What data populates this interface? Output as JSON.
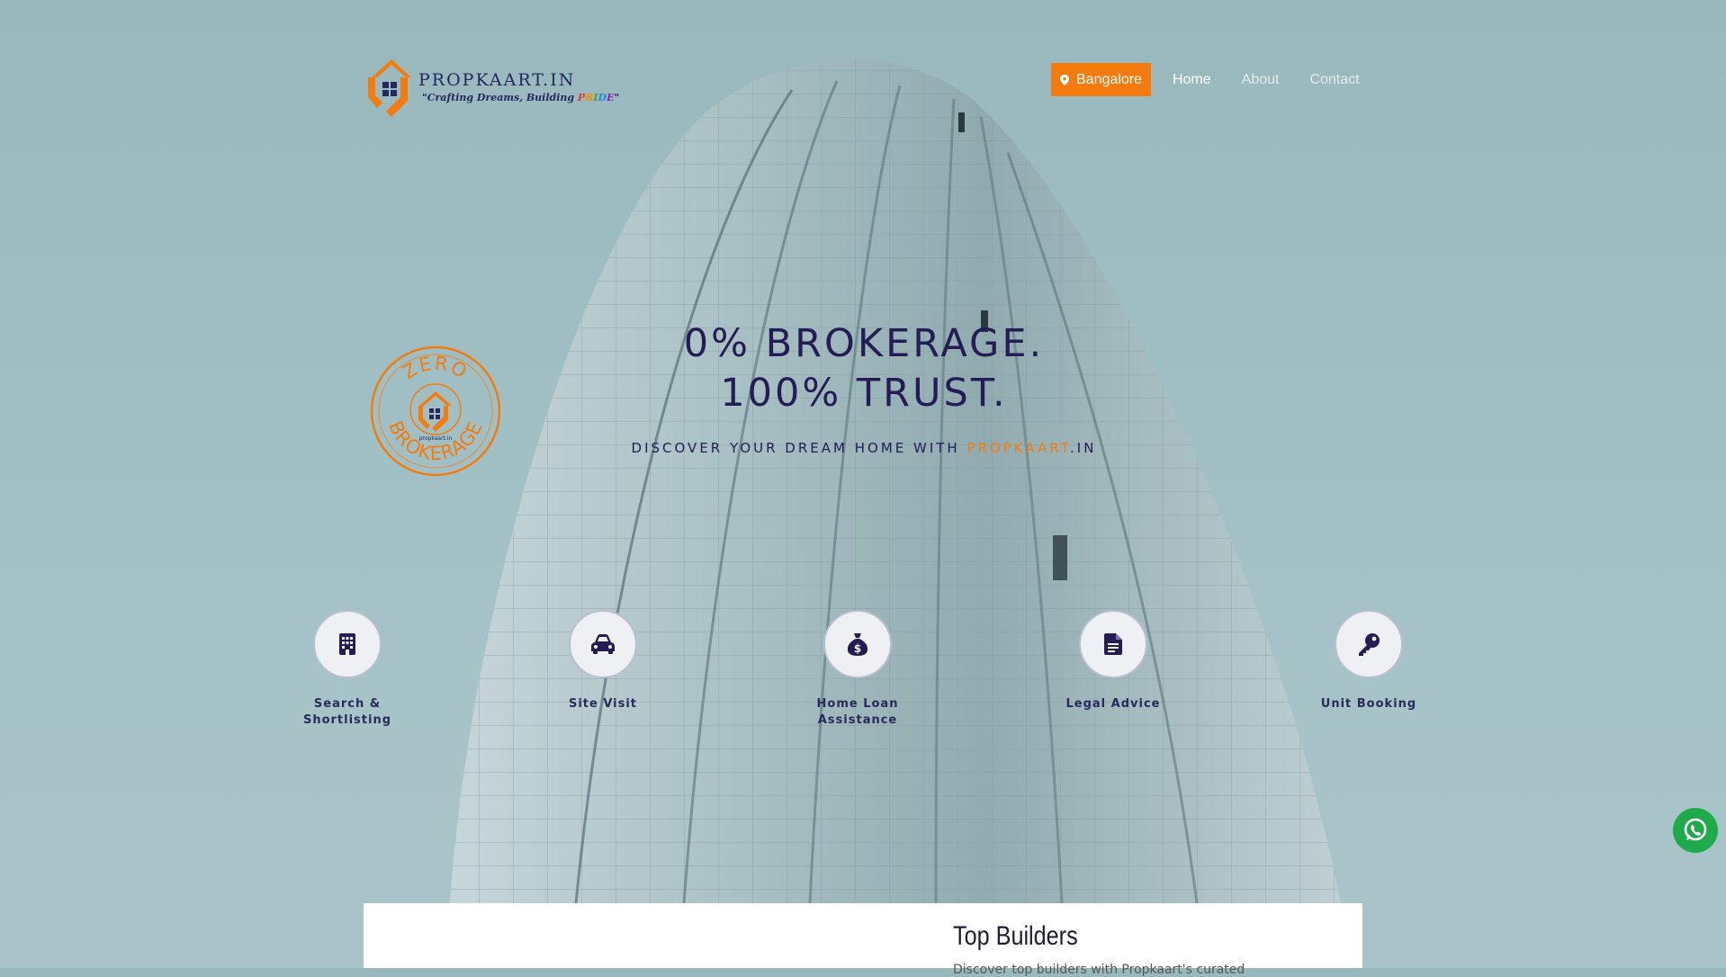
{
  "brand": {
    "name": "PROPKAART.IN",
    "tagline_parts": [
      "\"Crafting Dreams, Building ",
      "P",
      "R",
      "I",
      "D",
      "E",
      "\""
    ]
  },
  "nav": {
    "location": "Bangalore",
    "links": [
      "Home",
      "About",
      "Contact"
    ],
    "active": "Home"
  },
  "badge": {
    "top_text": "ZERO",
    "bottom_text": "BROKERAGE",
    "small_text": "propkaart.in"
  },
  "hero": {
    "headline_line1": "0% BROKERAGE.",
    "headline_line2": "100% TRUST.",
    "subtitle_prefix": "DISCOVER YOUR DREAM HOME WITH ",
    "subtitle_brand": "PROPKAART",
    "subtitle_suffix": ".IN"
  },
  "services": [
    {
      "label": "Search & Shortlisting",
      "icon": "building-icon"
    },
    {
      "label": "Site Visit",
      "icon": "car-icon"
    },
    {
      "label": "Home Loan Assistance",
      "icon": "money-bag-icon"
    },
    {
      "label": "Legal Advice",
      "icon": "document-icon"
    },
    {
      "label": "Unit Booking",
      "icon": "key-icon"
    }
  ],
  "section": {
    "title": "Top Builders",
    "description": "Discover top builders with Propkaart's curated"
  },
  "colors": {
    "accent": "#f47c0f",
    "navy": "#241c55",
    "whatsapp": "#1faa4b"
  }
}
